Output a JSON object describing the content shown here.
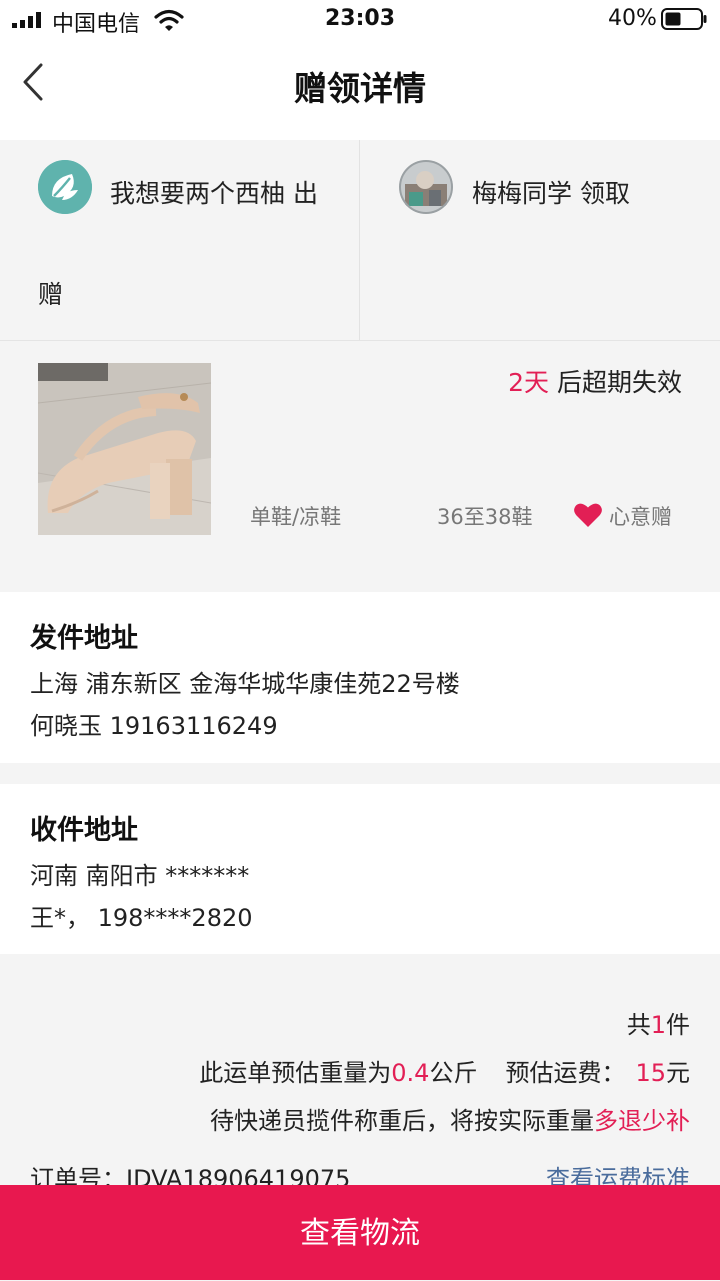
{
  "status_bar": {
    "carrier": "中国电信",
    "time": "23:03",
    "battery": "40%"
  },
  "nav": {
    "title": "赠领详情",
    "back_icon": "chevron-left-icon"
  },
  "parties": {
    "donor": {
      "text": "我想要两个西柚 出",
      "wrap": "赠"
    },
    "receiver": {
      "text": "梅梅同学 领取"
    }
  },
  "item": {
    "expiry_days": "2天",
    "expiry_suffix": " 后超期失效",
    "category": "单鞋/凉鞋",
    "size": "36至38鞋",
    "type": "心意赠"
  },
  "sender_address": {
    "title": "发件地址",
    "address": "上海 浦东新区 金海华城华康佳苑22号楼",
    "contact": "何晓玉 19163116249"
  },
  "receiver_address": {
    "title": "收件地址",
    "address": "河南 南阳市 *******",
    "contact": "王*，  198****2820"
  },
  "summary": {
    "count_prefix": "共",
    "count": "1",
    "count_suffix": "件",
    "weight_prefix": "此运单预估重量为",
    "weight": "0.4",
    "weight_unit": "公斤",
    "fee_label": "预估运费：",
    "fee": "15",
    "fee_unit": "元",
    "note_prefix": "待快递员揽件称重后，将按实际重量",
    "note_highlight": "多退少补",
    "order_label": "订单号：JDVA18906419075",
    "fee_standard_link": "查看运费标准"
  },
  "bottom_button": "查看物流",
  "colors": {
    "accent": "#e8184f",
    "highlight": "#e21f55",
    "link": "#4a6c9c"
  }
}
